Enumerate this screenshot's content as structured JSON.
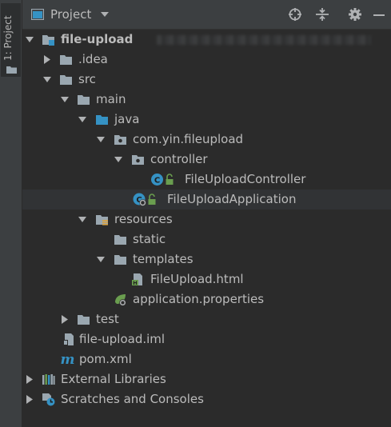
{
  "side_tab": {
    "label": "1: Project"
  },
  "header": {
    "title": "Project"
  },
  "toolbar": {
    "locate_icon": "crosshair-icon",
    "collapse_icon": "collapse-all-icon",
    "settings_icon": "gear-icon",
    "hide_icon": "minimize-icon"
  },
  "tree": {
    "project_root": "file-upload",
    "idea": ".idea",
    "src": "src",
    "main": "main",
    "java": "java",
    "package": "com.yin.fileupload",
    "controller": "controller",
    "controller_class": "FileUploadController",
    "application_class": "FileUploadApplication",
    "resources": "resources",
    "static": "static",
    "templates": "templates",
    "html_file": "FileUpload.html",
    "properties_file": "application.properties",
    "test": "test",
    "iml_file": "file-upload.iml",
    "pom": "pom.xml",
    "external_libraries": "External Libraries",
    "scratches": "Scratches and Consoles"
  },
  "colors": {
    "background": "#2b2b2b",
    "toolbar": "#3c3f41",
    "selected_row": "#0d293e",
    "text": "#bbbbbb",
    "folder": "#9aa7b0",
    "source_folder": "#3592c4",
    "class_icon": "#3592c4",
    "spring_green": "#6a9e4f"
  }
}
